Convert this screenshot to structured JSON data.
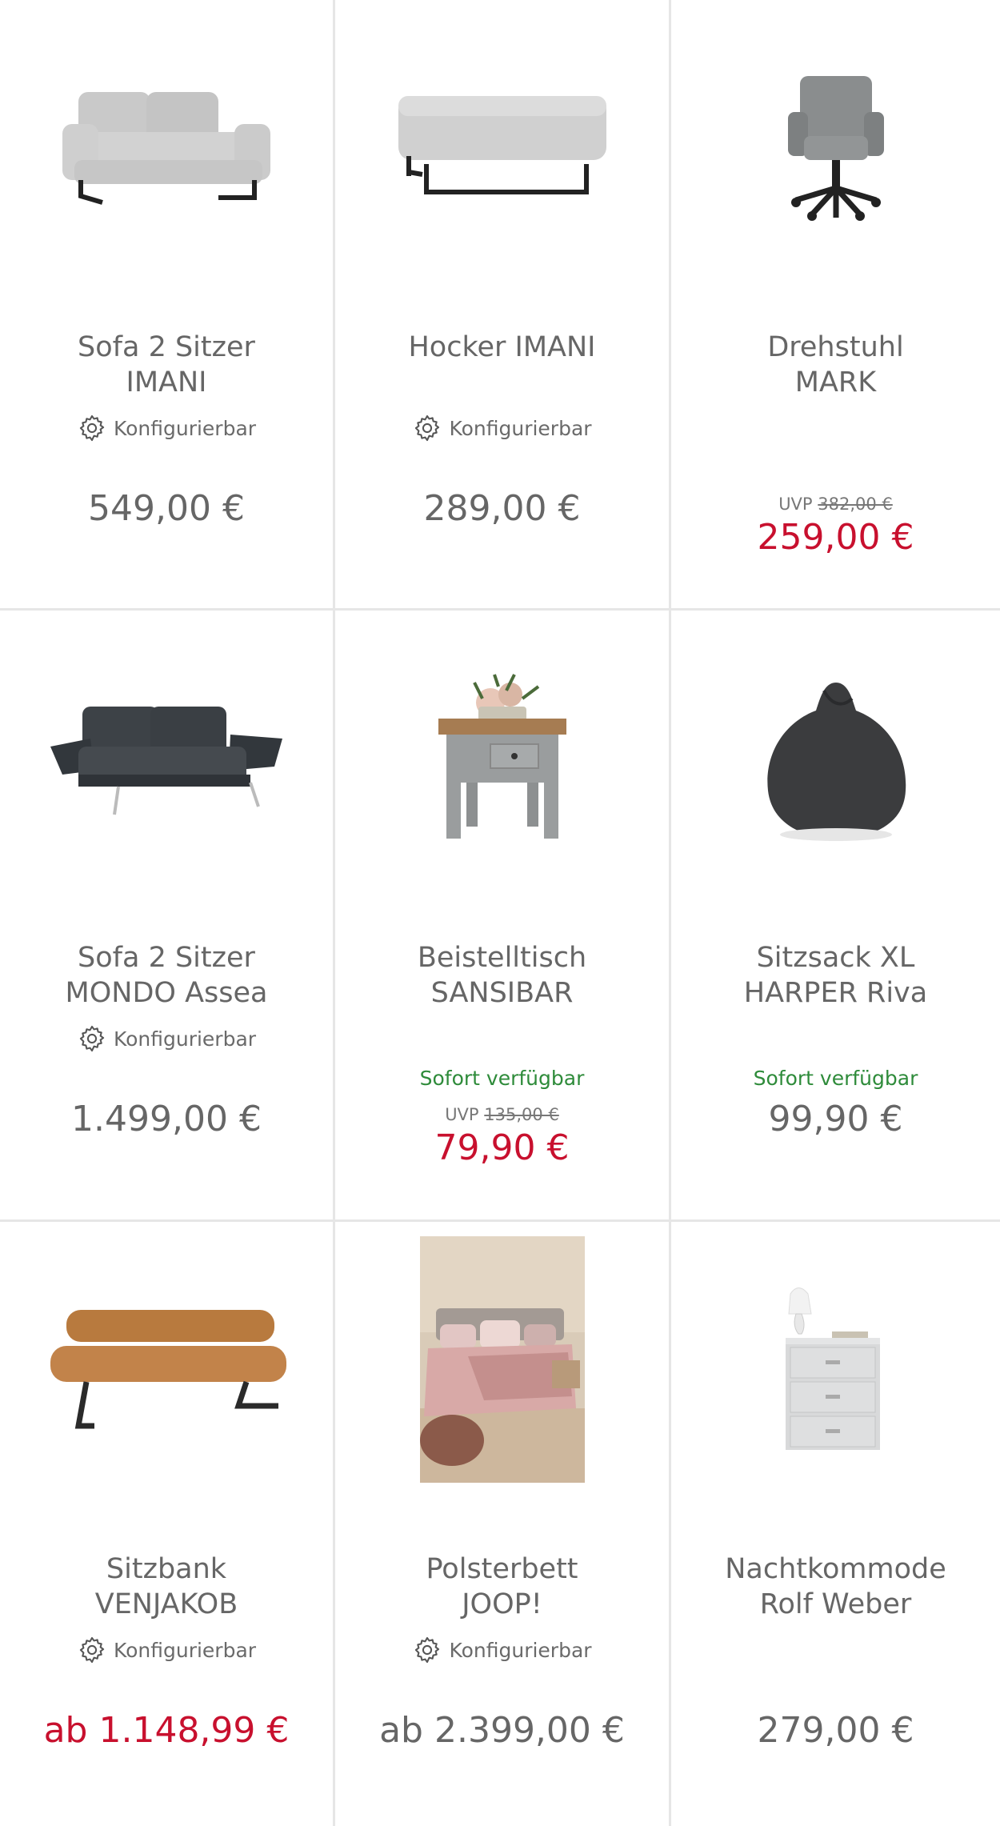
{
  "colors": {
    "sale_red": "#c8102e",
    "available_green": "#2e8b3a",
    "text_gray": "#666666",
    "divider": "#e6e6e6"
  },
  "config_icon": "gear-icon",
  "products": [
    {
      "name_line1": "Sofa 2 Sitzer",
      "name_line2": "IMANI",
      "config_label": "Konfigurierbar",
      "price": "549,00 €"
    },
    {
      "name_line1": "Hocker IMANI",
      "config_label": "Konfigurierbar",
      "price": "289,00 €"
    },
    {
      "name_line1": "Drehstuhl",
      "name_line2": "MARK",
      "uvp_label": "UVP",
      "uvp_price": "382,00 €",
      "price": "259,00 €"
    },
    {
      "name_line1": "Sofa 2 Sitzer",
      "name_line2": "MONDO Assea",
      "config_label": "Konfigurierbar",
      "price": "1.499,00 €"
    },
    {
      "name_line1": "Beistelltisch",
      "name_line2": "SANSIBAR",
      "availability": "Sofort verfügbar",
      "uvp_label": "UVP",
      "uvp_price": "135,00 €",
      "price": "79,90 €"
    },
    {
      "name_line1": "Sitzsack XL",
      "name_line2": "HARPER Riva",
      "availability": "Sofort verfügbar",
      "price": "99,90 €"
    },
    {
      "name_line1": "Sitzbank",
      "name_line2": "VENJAKOB",
      "config_label": "Konfigurierbar",
      "price": "ab 1.148,99 €"
    },
    {
      "name_line1": "Polsterbett",
      "name_line2": "JOOP!",
      "config_label": "Konfigurierbar",
      "price": "ab 2.399,00 €"
    },
    {
      "name_line1": "Nachtkommode",
      "name_line2": "Rolf Weber",
      "price": "279,00 €"
    }
  ]
}
